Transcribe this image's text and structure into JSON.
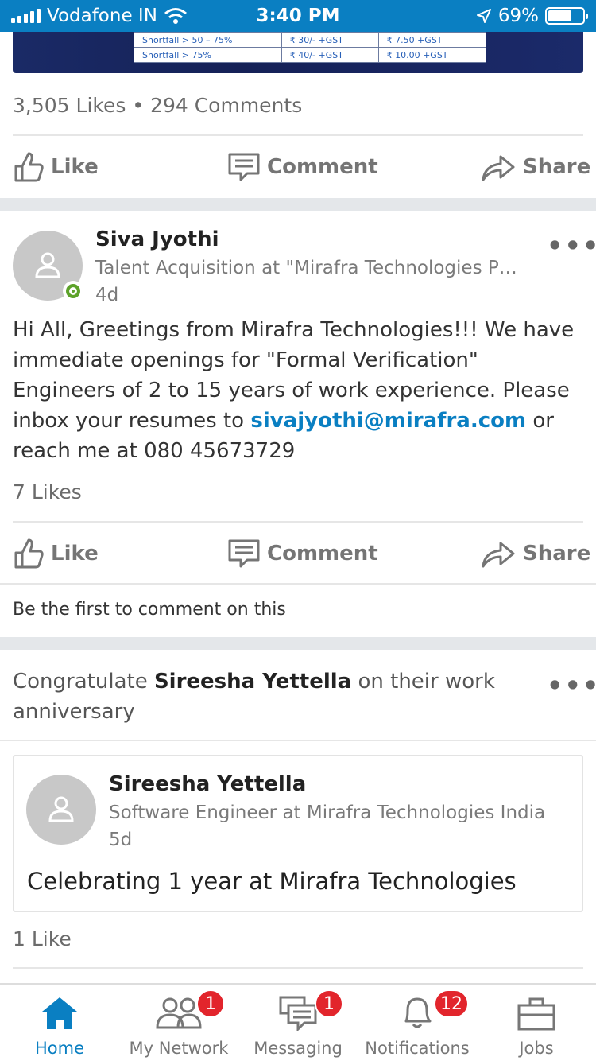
{
  "status_bar": {
    "carrier": "Vodafone IN",
    "time": "3:40 PM",
    "battery": "69%",
    "battery_level": 0.69
  },
  "previous_post": {
    "image_table": [
      [
        "Shortfall  > 50 – 75%",
        "₹ 30/- +GST",
        "₹ 7.50 +GST"
      ],
      [
        "Shortfall  > 75%",
        "₹ 40/- +GST",
        "₹ 10.00 +GST"
      ]
    ],
    "likes": "3,505 Likes",
    "separator": "•",
    "comments": "294 Comments"
  },
  "actions": {
    "like": "Like",
    "comment": "Comment",
    "share": "Share"
  },
  "post": {
    "author": "Siva Jyothi",
    "headline": "Talent Acquisition at \"Mirafra Technologies Pvt…",
    "age": "4d",
    "more": "•••",
    "body_part1": "Hi All, Greetings from Mirafra Technologies!!! We have immediate openings for \"Formal Verification\" Engineers of 2 to 15 years of work experience. Please inbox your resumes to ",
    "body_link": "sivajyothi@mirafra.com",
    "body_part2": " or reach me at 080 45673729",
    "likes": "7 Likes",
    "first_comment": "Be the first to comment on this"
  },
  "anniversary": {
    "prefix": "Congratulate ",
    "person": "Sireesha Yettella",
    "suffix": " on their work anniversary",
    "more": "•••",
    "card_name": "Sireesha Yettella",
    "card_headline": "Software Engineer at Mirafra Technologies India",
    "card_age": "5d",
    "card_text": "Celebrating 1 year at Mirafra Technologies",
    "likes": "1 Like"
  },
  "tabs": [
    {
      "label": "Home",
      "icon": "home-icon",
      "badge": ""
    },
    {
      "label": "My Network",
      "icon": "network-icon",
      "badge": "1"
    },
    {
      "label": "Messaging",
      "icon": "messaging-icon",
      "badge": "1"
    },
    {
      "label": "Notifications",
      "icon": "bell-icon",
      "badge": "12"
    },
    {
      "label": "Jobs",
      "icon": "briefcase-icon",
      "badge": ""
    }
  ],
  "colors": {
    "accent": "#0a7fc2",
    "badge": "#e2252c",
    "online": "#5da22a"
  }
}
